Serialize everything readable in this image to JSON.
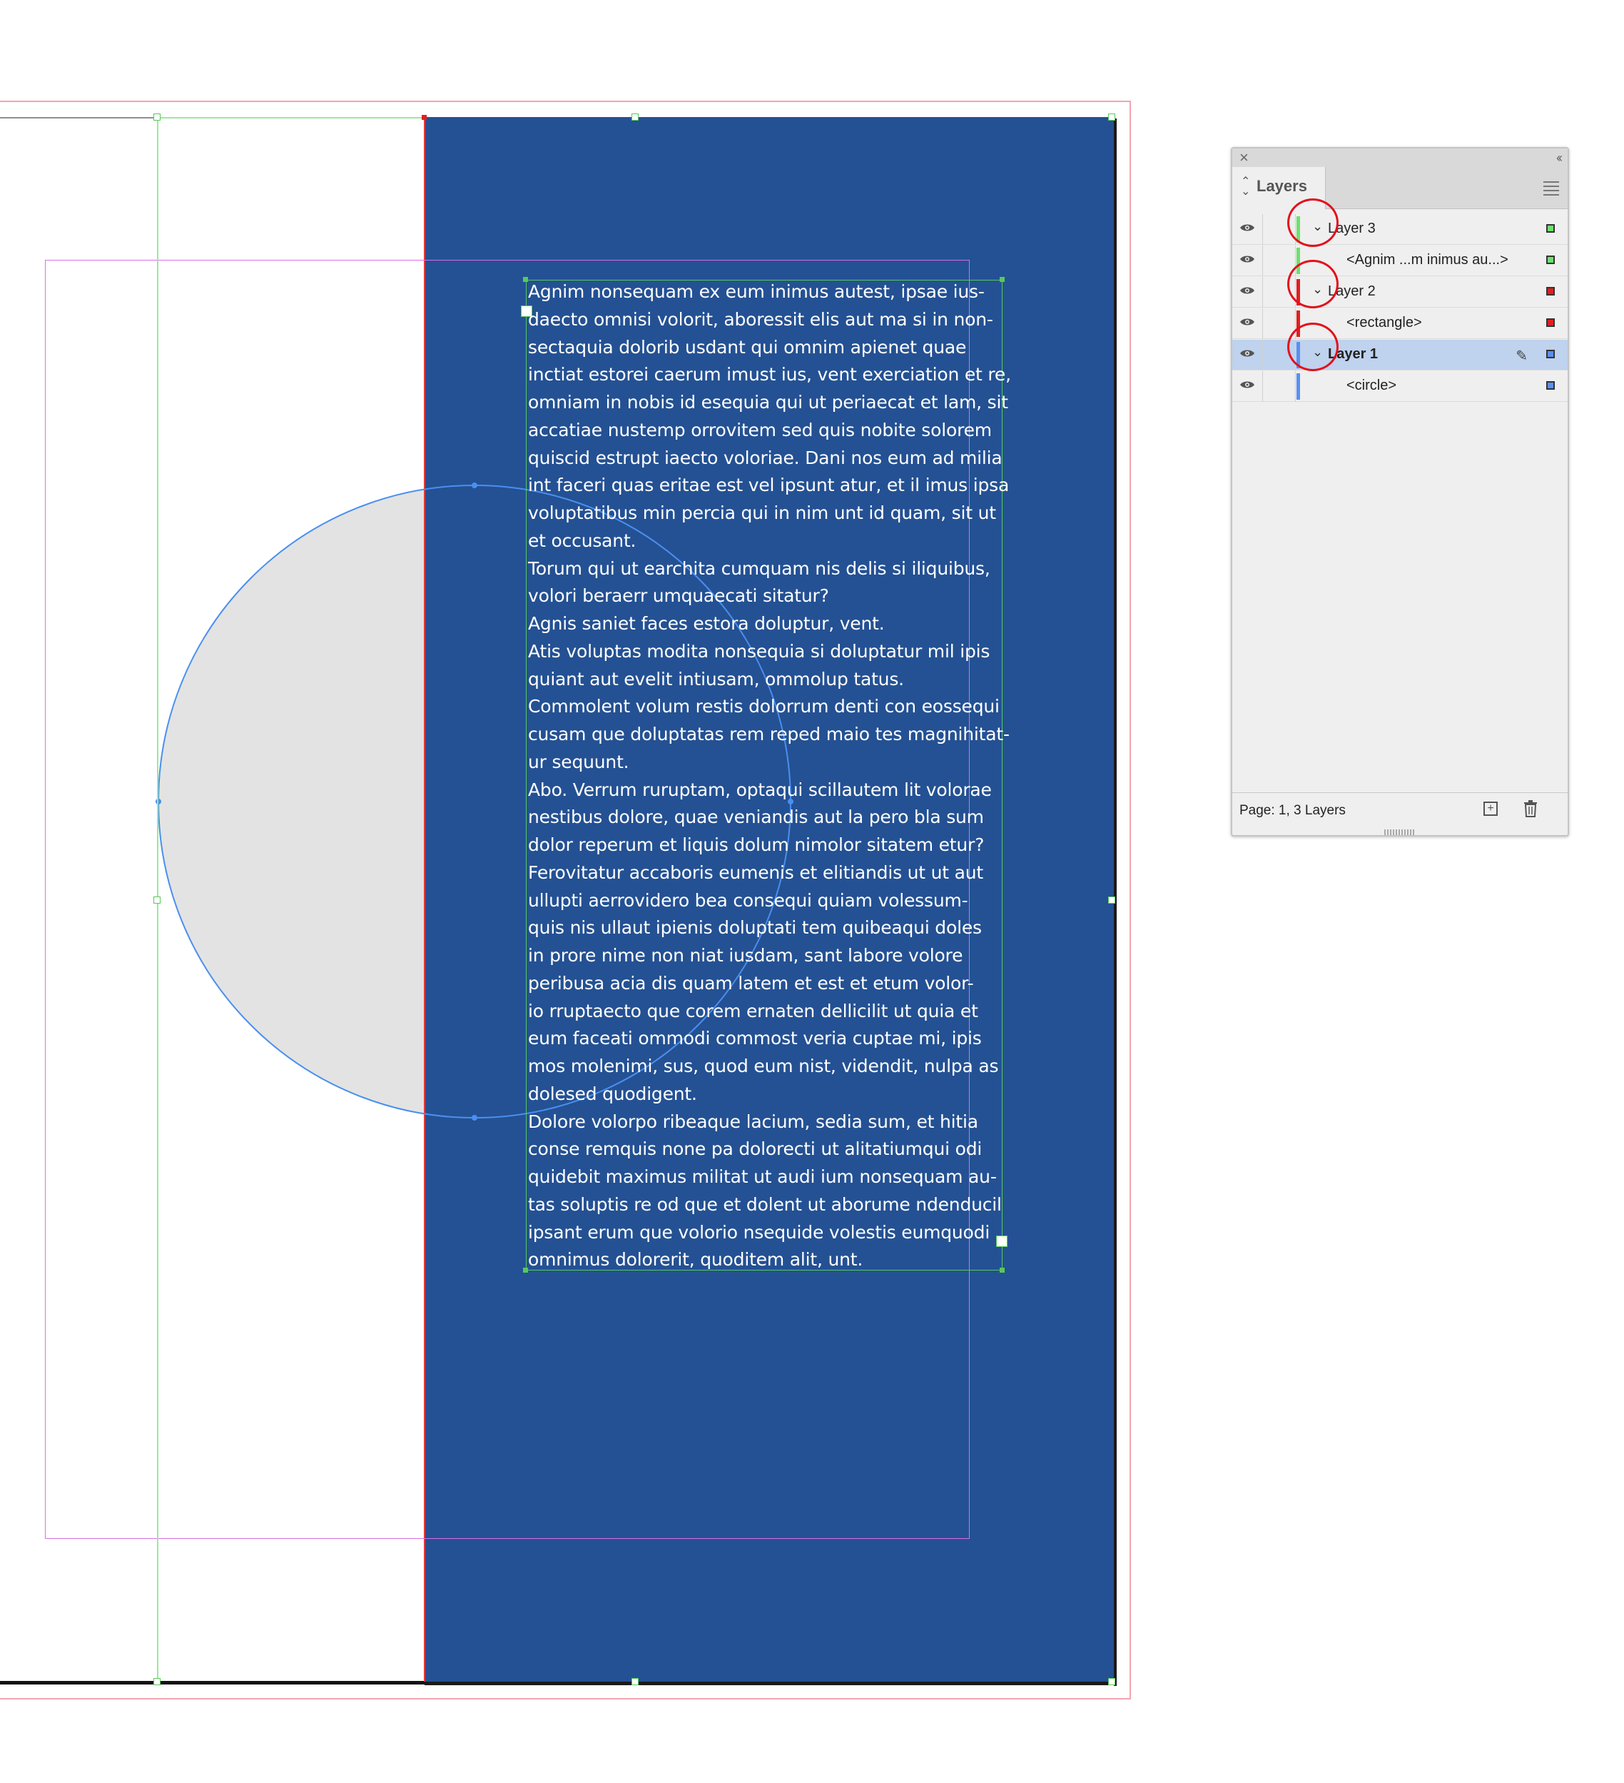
{
  "document": {
    "story_lines": [
      "Agnim nonsequam ex eum inimus autest, ipsae ius-",
      "daecto omnisi volorit, aboressit elis aut ma si in non-",
      "sectaquia dolorib usdant qui omnim apienet quae",
      "inctiat estorei caerum imust ius, vent exerciation et re,",
      "omniam in nobis id esequia qui ut periaecat et lam, sit",
      "accatiae nustemp orrovitem sed quis nobite solorem",
      "quiscid estrupt iaecto voloriae. Dani nos eum ad milia",
      "int faceri quas eritae est vel ipsunt atur, et il imus ipsa",
      "voluptatibus min percia qui in nim unt id quam, sit ut",
      "et occusant.",
      "Torum qui ut earchita cumquam nis delis si iliquibus,",
      "volori beraerr umquaecati sitatur?",
      "Agnis saniet faces estora doluptur, vent.",
      "Atis voluptas modita nonsequia si doluptatur mil ipis",
      "quiant aut evelit intiusam, ommolup tatus.",
      "Commolent volum restis dolorrum denti con eossequi",
      "cusam que doluptatas rem reped maio tes magnihitat-",
      "ur sequunt.",
      "Abo. Verrum ruruptam, optaqui scillautem lit volorae",
      "nestibus dolore, quae veniandis aut la pero bla sum",
      "dolor reperum et liquis dolum nimolor sitatem etur?",
      "Ferovitatur accaboris eumenis et elitiandis ut ut aut",
      "ullupti aerrovidero bea consequi quiam volessum-",
      "quis nis ullaut ipienis doluptati tem quibeaqui doles",
      "in prore nime non niat iusdam, sant labore volore",
      "peribusa acia dis quam latem et est et etum volor-",
      "io rruptaecto que corem ernaten dellicilit ut quia et",
      "eum faceati ommodi commost veria cuptae mi, ipis",
      "mos molenimi, sus, quod eum nist, videndit, nulpa as",
      "dolesed quodigent.",
      "Dolore volorpo ribeaque lacium, sedia sum, et hitia",
      "conse remquis none pa dolorecti ut alitatiumqui odi",
      "quidebit maximus militat ut audi ium nonsequam au-",
      "tas soluptis re od que et dolent ut aborume ndenducil",
      "ipsant erum que volorio nsequide volestis eumquodi",
      "omnimus dolorerit, quoditem alit, unt."
    ],
    "colors": {
      "rectangle_fill": "#245193",
      "circle_fill": "#e3e3e3",
      "circle_stroke": "#4a8ff0",
      "text_color": "#ffffff"
    }
  },
  "layers_panel": {
    "title": "Layers",
    "close_icon": "close-icon",
    "collapse_icon": "collapse-icon",
    "menu_icon": "panel-menu-icon",
    "rows": [
      {
        "kind": "layer",
        "label": "Layer 3",
        "color": "#6fe06f",
        "selected": false
      },
      {
        "kind": "object",
        "label": "<Agnim ...m inimus au...>",
        "color": "#6fe06f",
        "selected": false
      },
      {
        "kind": "layer",
        "label": "Layer 2",
        "color": "#e02020",
        "selected": false
      },
      {
        "kind": "object",
        "label": "<rectangle>",
        "color": "#e02020",
        "selected": false
      },
      {
        "kind": "layer",
        "label": "Layer 1",
        "color": "#5b8ff0",
        "selected": true
      },
      {
        "kind": "object",
        "label": "<circle>",
        "color": "#5b8ff0",
        "selected": false
      }
    ],
    "footer": "Page: 1, 3 Layers",
    "new_layer_icon": "new-layer-icon",
    "delete_icon": "trash-icon"
  },
  "annotations": {
    "highlight_color": "#e3101b"
  }
}
